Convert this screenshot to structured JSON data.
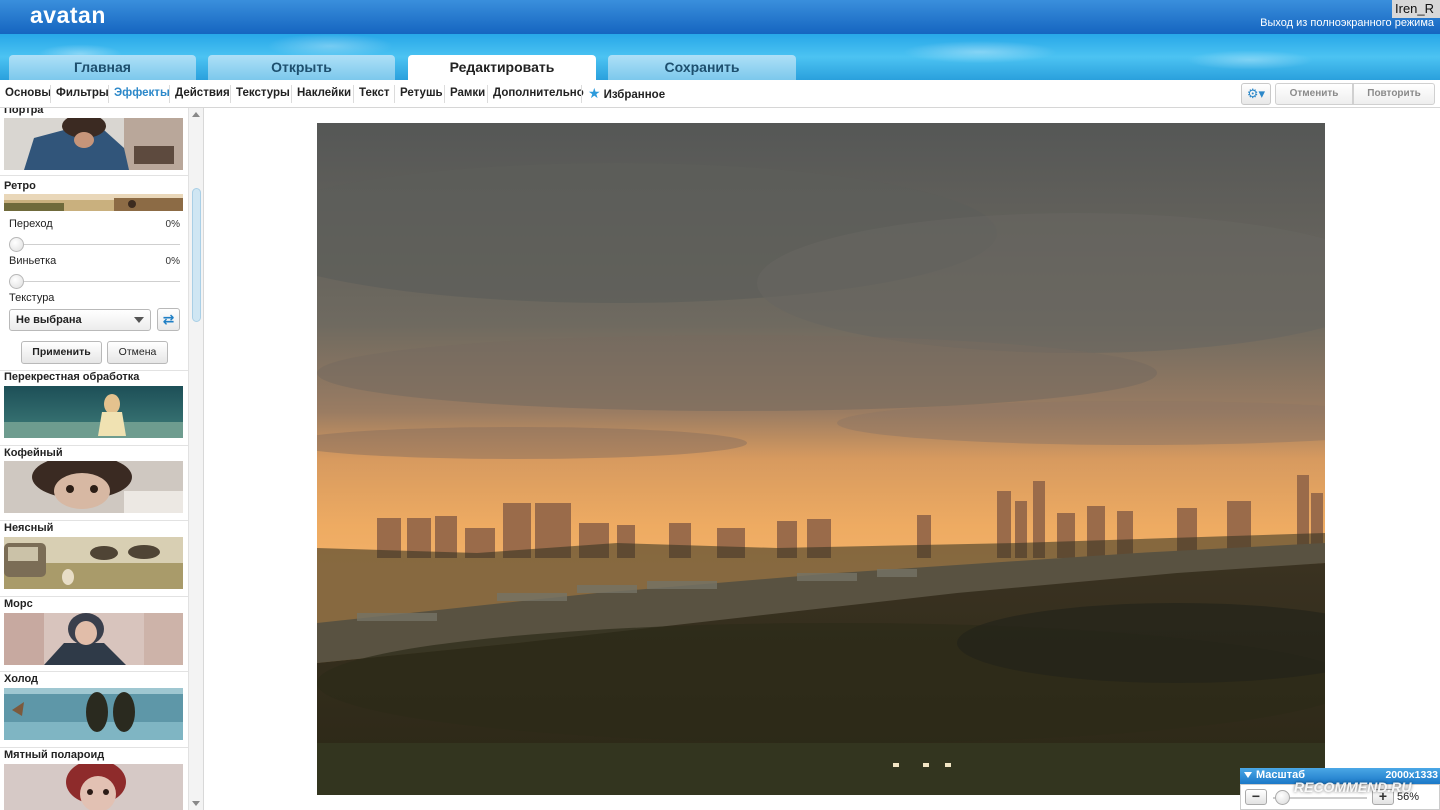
{
  "header": {
    "logo": "avatan",
    "user": "Iren_R",
    "exit_fullscreen": "Выход из полноэкранного режима"
  },
  "main_tabs": [
    {
      "label": "Главная"
    },
    {
      "label": "Открыть"
    },
    {
      "label": "Редактировать",
      "active": true
    },
    {
      "label": "Сохранить"
    }
  ],
  "sub_tabs": [
    {
      "label": "Основы"
    },
    {
      "label": "Фильтры"
    },
    {
      "label": "Эффекты",
      "active": true
    },
    {
      "label": "Действия"
    },
    {
      "label": "Текстуры"
    },
    {
      "label": "Наклейки"
    },
    {
      "label": "Текст"
    },
    {
      "label": "Ретушь"
    },
    {
      "label": "Рамки"
    },
    {
      "label": "Дополнительно"
    },
    {
      "label": "Избранное",
      "icon": "star-icon"
    }
  ],
  "toolbar_right": {
    "settings_icon": "gear-icon",
    "undo": "Отменить",
    "redo": "Повторить"
  },
  "panel": {
    "effects": [
      {
        "label": "Портра"
      },
      {
        "label": "Ретро"
      },
      {
        "label": "Перекрестная обработка"
      },
      {
        "label": "Кофейный"
      },
      {
        "label": "Неясный"
      },
      {
        "label": "Морс"
      },
      {
        "label": "Холод"
      },
      {
        "label": "Мятный полароид"
      }
    ],
    "settings": {
      "transition_label": "Переход",
      "transition_value": "0%",
      "transition_level": 0,
      "vignette_label": "Виньетка",
      "vignette_value": "0%",
      "vignette_level": 0,
      "texture_label": "Текстура",
      "texture_selected": "Не выбрана",
      "shuffle_icon": "shuffle-icon",
      "apply": "Применить",
      "cancel": "Отмена"
    }
  },
  "zoom": {
    "label": "Масштаб",
    "dimensions": "2000x1333",
    "value": "56%",
    "level": 0.56
  },
  "watermark": "RECOMMEND.RU",
  "colors": {
    "accent": "#2c88c9",
    "header": "#1565c0"
  }
}
